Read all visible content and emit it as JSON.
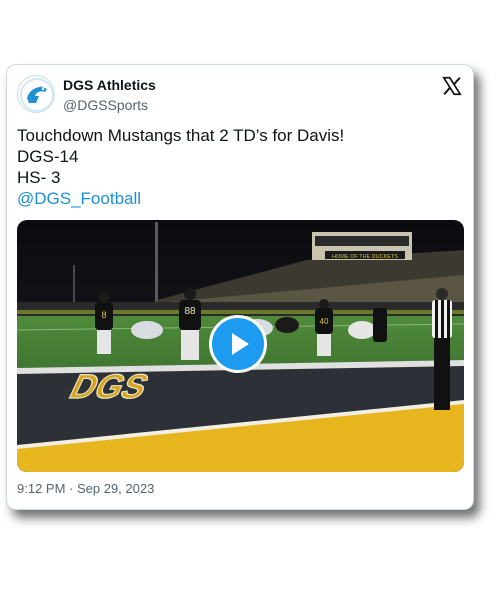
{
  "tweet": {
    "author_name": "DGS Athletics",
    "author_handle": "@DGSSports",
    "lines": [
      "Touchdown Mustangs that 2 TD’s for Davis!",
      "DGS-14",
      "HS- 3"
    ],
    "mention": "@DGS_Football",
    "timestamp": "9:12 PM · Sep 29, 2023"
  },
  "media": {
    "stadium_sign": "HOME OF THE DUCKETS",
    "jersey_numbers": [
      "8",
      "88",
      "40"
    ],
    "field_lettering": "DGS"
  },
  "icons": {
    "platform": "x-logo-icon",
    "video_control": "play-icon"
  },
  "colors": {
    "accent": "#1d9bf0",
    "link": "#1d8fd4",
    "text": "#0f1419",
    "muted": "#536471"
  }
}
